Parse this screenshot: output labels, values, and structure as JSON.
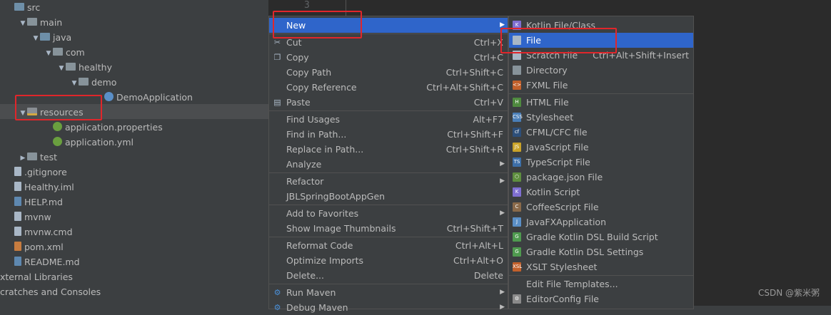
{
  "tree": [
    {
      "label": "src",
      "indent": 0,
      "arrow": "",
      "icon": "folder-src",
      "selected": false
    },
    {
      "label": "main",
      "indent": 1,
      "arrow": "▼",
      "icon": "folder",
      "selected": false
    },
    {
      "label": "java",
      "indent": 2,
      "arrow": "▼",
      "icon": "folder-src",
      "selected": false
    },
    {
      "label": "com",
      "indent": 3,
      "arrow": "▼",
      "icon": "folder",
      "selected": false
    },
    {
      "label": "healthy",
      "indent": 4,
      "arrow": "▼",
      "icon": "folder",
      "selected": false
    },
    {
      "label": "demo",
      "indent": 5,
      "arrow": "▼",
      "icon": "folder",
      "selected": false
    },
    {
      "label": "DemoApplication",
      "indent": 7,
      "arrow": "",
      "icon": "class",
      "selected": false
    },
    {
      "label": "resources",
      "indent": 1,
      "arrow": "▼",
      "icon": "folder-res",
      "selected": true
    },
    {
      "label": "application.properties",
      "indent": 3,
      "arrow": "",
      "icon": "leaf",
      "selected": false
    },
    {
      "label": "application.yml",
      "indent": 3,
      "arrow": "",
      "icon": "leaf",
      "selected": false
    },
    {
      "label": "test",
      "indent": 1,
      "arrow": "▶",
      "icon": "folder",
      "selected": false
    },
    {
      "label": ".gitignore",
      "indent": 0,
      "arrow": "",
      "icon": "file",
      "selected": false
    },
    {
      "label": "Healthy.iml",
      "indent": 0,
      "arrow": "",
      "icon": "file",
      "selected": false
    },
    {
      "label": "HELP.md",
      "indent": 0,
      "arrow": "",
      "icon": "file-md",
      "selected": false
    },
    {
      "label": "mvnw",
      "indent": 0,
      "arrow": "",
      "icon": "file",
      "selected": false
    },
    {
      "label": "mvnw.cmd",
      "indent": 0,
      "arrow": "",
      "icon": "file",
      "selected": false
    },
    {
      "label": "pom.xml",
      "indent": 0,
      "arrow": "",
      "icon": "file-xml",
      "selected": false
    },
    {
      "label": "README.md",
      "indent": 0,
      "arrow": "",
      "icon": "file-md",
      "selected": false
    },
    {
      "label": "xternal Libraries",
      "indent": -1,
      "arrow": "",
      "icon": "",
      "selected": false
    },
    {
      "label": "cratches and Consoles",
      "indent": -1,
      "arrow": "",
      "icon": "",
      "selected": false
    }
  ],
  "editor": {
    "line_number": "3"
  },
  "context_menu": [
    {
      "label": "New",
      "shortcut": "",
      "arrow": true,
      "highlighted": true,
      "icon": ""
    },
    {
      "sep": true
    },
    {
      "label": "Cut",
      "shortcut": "Ctrl+X",
      "icon": "scissors-icon"
    },
    {
      "label": "Copy",
      "shortcut": "Ctrl+C",
      "icon": "copy-icon"
    },
    {
      "label": "Copy Path",
      "shortcut": "Ctrl+Shift+C",
      "icon": ""
    },
    {
      "label": "Copy Reference",
      "shortcut": "Ctrl+Alt+Shift+C",
      "icon": ""
    },
    {
      "label": "Paste",
      "shortcut": "Ctrl+V",
      "icon": "paste-icon"
    },
    {
      "sep": true
    },
    {
      "label": "Find Usages",
      "shortcut": "Alt+F7",
      "icon": ""
    },
    {
      "label": "Find in Path...",
      "shortcut": "Ctrl+Shift+F",
      "icon": ""
    },
    {
      "label": "Replace in Path...",
      "shortcut": "Ctrl+Shift+R",
      "icon": ""
    },
    {
      "label": "Analyze",
      "shortcut": "",
      "arrow": true,
      "icon": ""
    },
    {
      "sep": true
    },
    {
      "label": "Refactor",
      "shortcut": "",
      "arrow": true,
      "icon": ""
    },
    {
      "label": "JBLSpringBootAppGen",
      "shortcut": "",
      "icon": ""
    },
    {
      "sep": true
    },
    {
      "label": "Add to Favorites",
      "shortcut": "",
      "arrow": true,
      "icon": ""
    },
    {
      "label": "Show Image Thumbnails",
      "shortcut": "Ctrl+Shift+T",
      "icon": ""
    },
    {
      "sep": true
    },
    {
      "label": "Reformat Code",
      "shortcut": "Ctrl+Alt+L",
      "icon": ""
    },
    {
      "label": "Optimize Imports",
      "shortcut": "Ctrl+Alt+O",
      "icon": ""
    },
    {
      "label": "Delete...",
      "shortcut": "Delete",
      "icon": ""
    },
    {
      "sep": true
    },
    {
      "label": "Run Maven",
      "shortcut": "",
      "arrow": true,
      "icon": "gear-icon"
    },
    {
      "label": "Debug Maven",
      "shortcut": "",
      "arrow": true,
      "icon": "gear-icon"
    }
  ],
  "submenu": [
    {
      "label": "Kotlin File/Class",
      "shortcut": "",
      "icon": "kotlin-file-icon",
      "color": "#7f6fd1",
      "letter": "K"
    },
    {
      "label": "File",
      "shortcut": "",
      "highlighted": true,
      "icon": "file-icon",
      "color": "#a9b7c6",
      "letter": ""
    },
    {
      "label": "Scratch File",
      "shortcut": "Ctrl+Alt+Shift+Insert",
      "icon": "scratch-file-icon",
      "color": "#a9b7c6",
      "letter": ""
    },
    {
      "label": "Directory",
      "shortcut": "",
      "icon": "directory-icon",
      "color": "#87939a",
      "letter": ""
    },
    {
      "label": "FXML File",
      "shortcut": "",
      "icon": "fxml-file-icon",
      "color": "#c2602b",
      "letter": "<>"
    },
    {
      "sep": true
    },
    {
      "label": "HTML File",
      "shortcut": "",
      "icon": "html-file-icon",
      "color": "#4f8a3f",
      "letter": "H"
    },
    {
      "label": "Stylesheet",
      "shortcut": "",
      "icon": "stylesheet-icon",
      "color": "#4a7fb8",
      "letter": "CSS"
    },
    {
      "label": "CFML/CFC file",
      "shortcut": "",
      "icon": "cfml-file-icon",
      "color": "#2d4f7a",
      "letter": "cf"
    },
    {
      "label": "JavaScript File",
      "shortcut": "",
      "icon": "javascript-file-icon",
      "color": "#c9a228",
      "letter": "JS"
    },
    {
      "label": "TypeScript File",
      "shortcut": "",
      "icon": "typescript-file-icon",
      "color": "#3d6fa8",
      "letter": "TS"
    },
    {
      "label": "package.json File",
      "shortcut": "",
      "icon": "package-json-icon",
      "color": "#5e8e3e",
      "letter": "⬡"
    },
    {
      "label": "Kotlin Script",
      "shortcut": "",
      "icon": "kotlin-script-icon",
      "color": "#7f6fd1",
      "letter": "K"
    },
    {
      "label": "CoffeeScript File",
      "shortcut": "",
      "icon": "coffeescript-file-icon",
      "color": "#8a6a4a",
      "letter": "C"
    },
    {
      "label": "JavaFXApplication",
      "shortcut": "",
      "icon": "javafx-icon",
      "color": "#5a8fc7",
      "letter": "J"
    },
    {
      "label": "Gradle Kotlin DSL Build Script",
      "shortcut": "",
      "icon": "gradle-build-icon",
      "color": "#4f9a4f",
      "letter": "G"
    },
    {
      "label": "Gradle Kotlin DSL Settings",
      "shortcut": "",
      "icon": "gradle-settings-icon",
      "color": "#4f9a4f",
      "letter": "G"
    },
    {
      "label": "XSLT Stylesheet",
      "shortcut": "",
      "icon": "xslt-icon",
      "color": "#c2602b",
      "letter": "XSL"
    },
    {
      "sep": true
    },
    {
      "label": "Edit File Templates...",
      "shortcut": "",
      "icon": "",
      "color": "",
      "letter": ""
    },
    {
      "label": "EditorConfig File",
      "shortcut": "",
      "icon": "editorconfig-icon",
      "color": "#8a8a8a",
      "letter": "⚙"
    }
  ],
  "watermark": "CSDN @紫米粥"
}
